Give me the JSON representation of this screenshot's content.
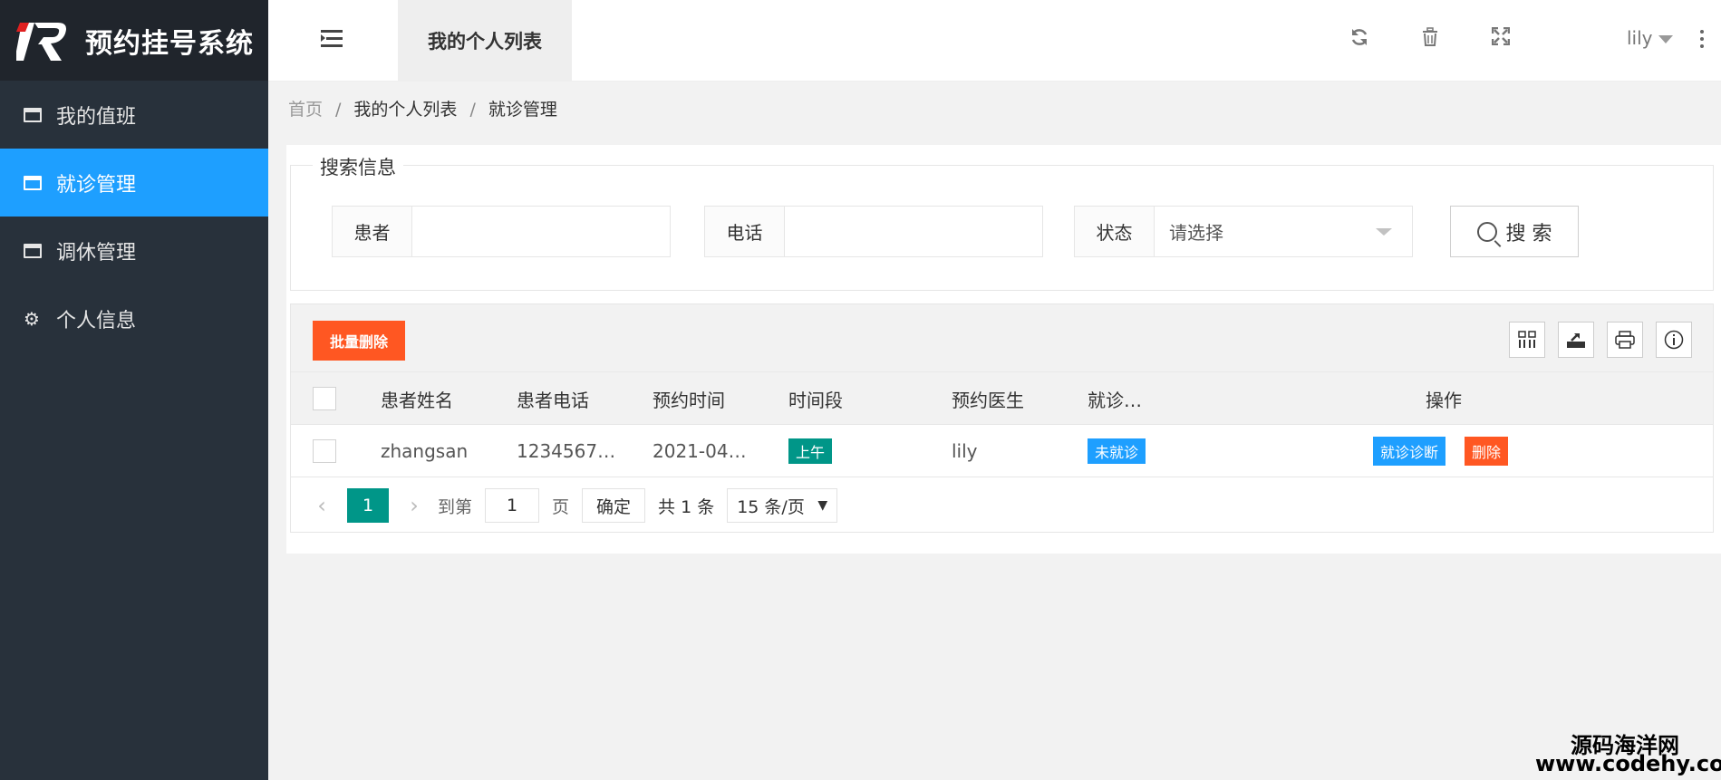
{
  "app": {
    "title": "预约挂号系统"
  },
  "sidebar": {
    "items": [
      {
        "label": "我的值班",
        "icon": "window-icon",
        "active": false
      },
      {
        "label": "就诊管理",
        "icon": "window-icon",
        "active": true
      },
      {
        "label": "调休管理",
        "icon": "window-icon",
        "active": false
      },
      {
        "label": "个人信息",
        "icon": "gears-icon",
        "active": false
      }
    ]
  },
  "header": {
    "tab_label": "我的个人列表",
    "user": "lily"
  },
  "breadcrumb": {
    "home": "首页",
    "sep": "/",
    "level1": "我的个人列表",
    "level2": "就诊管理"
  },
  "search": {
    "legend": "搜索信息",
    "patient_label": "患者",
    "patient_value": "",
    "phone_label": "电话",
    "phone_value": "",
    "status_label": "状态",
    "status_placeholder": "请选择",
    "button_label": "搜 索"
  },
  "toolbar": {
    "batch_delete": "批量删除"
  },
  "table": {
    "columns": [
      "患者姓名",
      "患者电话",
      "预约时间",
      "时间段",
      "预约医生",
      "就诊…",
      "操作"
    ],
    "rows": [
      {
        "name": "zhangsan",
        "phone": "1234567…",
        "time": "2021-04…",
        "period": "上午",
        "doctor": "lily",
        "status": "未就诊",
        "action_diagnose": "就诊诊断",
        "action_delete": "删除"
      }
    ]
  },
  "pager": {
    "current": "1",
    "goto_label": "到第",
    "goto_value": "1",
    "page_unit": "页",
    "confirm": "确定",
    "total": "共 1 条",
    "page_size": "15 条/页"
  },
  "watermark": {
    "line1": "源码海洋网",
    "line2": "www.codehy.com"
  },
  "colors": {
    "sidebar_bg": "#28313b",
    "active_blue": "#1e9fff",
    "danger_orange": "#ff5722",
    "teal": "#009688"
  }
}
